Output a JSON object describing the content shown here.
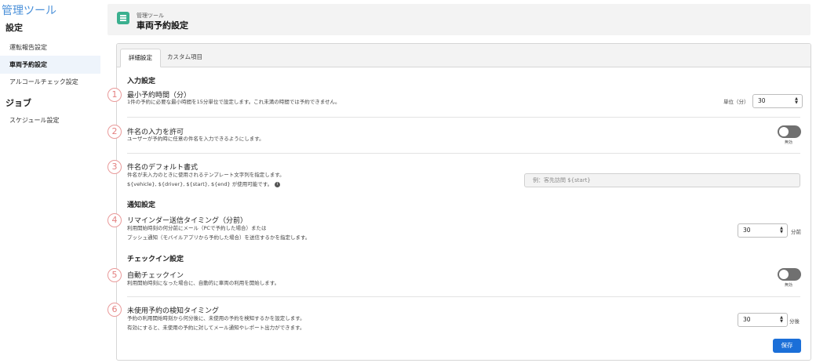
{
  "sidebar": {
    "app_title": "管理ツール",
    "section_settings": "設定",
    "items_settings": [
      "運転報告設定",
      "車両予約設定",
      "アルコールチェック設定"
    ],
    "section_jobs": "ジョブ",
    "items_jobs": [
      "スケジュール設定"
    ],
    "active_item": "車両予約設定"
  },
  "header": {
    "subtitle": "管理ツール",
    "title": "車両予約設定",
    "icon": "document-icon",
    "icon_color": "#3bb08f"
  },
  "tabs": [
    "詳細設定",
    "カスタム項目"
  ],
  "groups": {
    "input": "入力設定",
    "notify": "通知設定",
    "checkin": "チェックイン設定"
  },
  "settings": [
    {
      "num": "1",
      "title": "最小予約時間（分）",
      "desc": [
        "1件の予約に必要な最小時間を15分単位で設定します。これ未満の時間では予約できません。"
      ],
      "control": "select",
      "unit_prefix": "単位（分）",
      "value": "30"
    },
    {
      "num": "2",
      "title": "件名の入力を許可",
      "desc": [
        "ユーザーが予約時に任意の件名を入力できるようにします。"
      ],
      "control": "toggle",
      "state": "無効"
    },
    {
      "num": "3",
      "title": "件名のデフォルト書式",
      "desc": [
        "件名が未入力のときに使用されるテンプレート文字列を指定します。",
        "${vehicle}, ${driver}, ${start}, ${end} が使用可能です。"
      ],
      "control": "text",
      "placeholder": "例：客先訪問 ${start}"
    },
    {
      "num": "4",
      "title": "リマインダー送信タイミング（分前）",
      "desc": [
        "利用開始時刻の何分前にメール（PCで予約した場合）または",
        "プッシュ通知（モバイルアプリから予約した場合）を送信するかを指定します。"
      ],
      "control": "select",
      "value": "30",
      "unit_suffix": "分前"
    },
    {
      "num": "5",
      "title": "自動チェックイン",
      "desc": [
        "利用開始時刻になった場合に、自動的に車両の利用を開始します。"
      ],
      "control": "toggle",
      "state": "無効"
    },
    {
      "num": "6",
      "title": "未使用予約の検知タイミング",
      "desc": [
        "予約の利用開始時刻から何分後に、未使用の予約を検知するかを設定します。",
        "有効にすると、未使用の予約に対してメール通知やレポート出力ができます。"
      ],
      "control": "select",
      "value": "30",
      "unit_suffix": "分後"
    }
  ],
  "save_label": "保存",
  "colors": {
    "accent": "#1b6fd8",
    "sidebar_title": "#4a90d9",
    "badge": "#e48080",
    "toggle_off": "#707070"
  }
}
